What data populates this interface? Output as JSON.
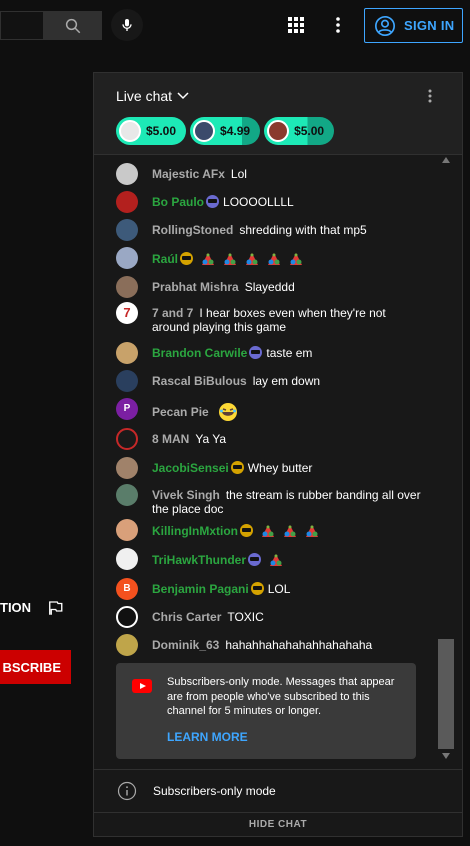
{
  "topbar": {
    "signin_label": "SIGN IN",
    "icons": [
      "search-icon",
      "mic-icon",
      "apps-icon",
      "more-vert-icon",
      "account-icon"
    ]
  },
  "left": {
    "action_label": "TION",
    "subscribe_label": "BSCRIBE"
  },
  "chat": {
    "title": "Live chat",
    "tickers": [
      {
        "amount": "$5.00",
        "avatar_color": "#e8e8e8"
      },
      {
        "amount": "$4.99",
        "avatar_color": "#3b4a6b"
      },
      {
        "amount": "$5.00",
        "avatar_color": "#8a3a2e"
      }
    ],
    "messages": [
      {
        "author": "Majestic AFx",
        "text": "Lol",
        "member": false,
        "avatar_color": "#c9c9c9",
        "initial": ""
      },
      {
        "author": "Bo Paulo",
        "text": "LOOOOLLLL",
        "member": true,
        "avatar_color": "#b3201e",
        "initial": ""
      },
      {
        "author": "RollingStoned",
        "text": "shredding with that mp5",
        "member": false,
        "avatar_color": "#3d5a7a",
        "initial": ""
      },
      {
        "author": "Raúl",
        "text": "",
        "member": true,
        "avatar_color": "#9aa8c4",
        "initial": ""
      },
      {
        "author": "Prabhat Mishra",
        "text": "Slayeddd",
        "member": false,
        "avatar_color": "#8a6e5a",
        "initial": ""
      },
      {
        "author": "7 and 7",
        "text": "I hear boxes even when they're not around playing this game",
        "member": false,
        "avatar_color": "#ffffff",
        "initial": "7"
      },
      {
        "author": "Brandon Carwile",
        "text": "taste em",
        "member": true,
        "avatar_color": "#c8a26a",
        "initial": ""
      },
      {
        "author": "Rascal BiBulous",
        "text": "lay em down",
        "member": false,
        "avatar_color": "#2a3f5e",
        "initial": ""
      },
      {
        "author": "Pecan Pie",
        "text": "",
        "member": false,
        "avatar_color": "#7b1fa2",
        "initial": "P"
      },
      {
        "author": "8 MAN",
        "text": "Ya Ya",
        "member": false,
        "avatar_color": "#1a1a1a",
        "initial": ""
      },
      {
        "author": "JacobiSensei",
        "text": "Whey butter",
        "member": true,
        "avatar_color": "#a0826a",
        "initial": ""
      },
      {
        "author": "Vivek Singh",
        "text": "the stream is rubber banding all over the place doc",
        "member": false,
        "avatar_color": "#5a7d6a",
        "initial": ""
      },
      {
        "author": "KillingInMxtion",
        "text": "",
        "member": true,
        "avatar_color": "#d9a07a",
        "initial": ""
      },
      {
        "author": "TriHawkThunder",
        "text": "",
        "member": true,
        "avatar_color": "#f0f0f0",
        "initial": ""
      },
      {
        "author": "Benjamin Pagani",
        "text": "LOL",
        "member": true,
        "avatar_color": "#f4511e",
        "initial": "B"
      },
      {
        "author": "Chris Carter",
        "text": "TOXIC",
        "member": false,
        "avatar_color": "#111111",
        "initial": ""
      },
      {
        "author": "Dominik_63",
        "text": "hahahhahahahahhahahaha",
        "member": false,
        "avatar_color": "#bfa54a",
        "initial": ""
      }
    ],
    "notice": {
      "text": "Subscribers-only mode. Messages that appear are from people who've subscribed to this channel for 5 minutes or longer.",
      "link": "LEARN MORE"
    },
    "footer": {
      "mode_label": "Subscribers-only mode",
      "hide_label": "HIDE CHAT"
    }
  }
}
